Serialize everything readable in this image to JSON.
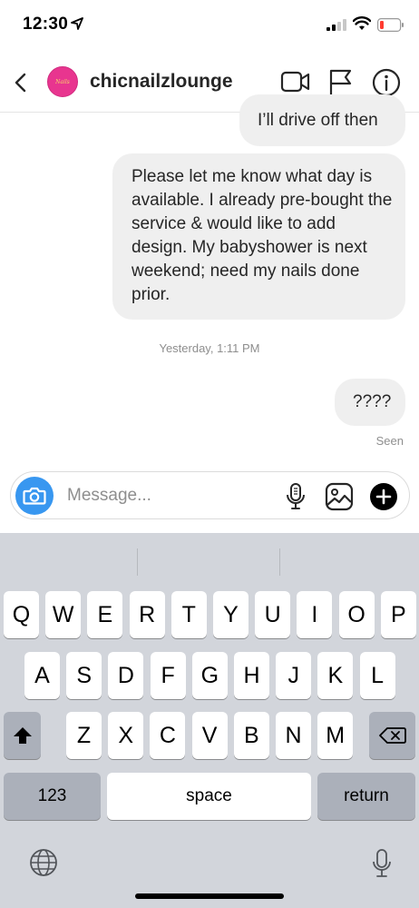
{
  "status_bar": {
    "time": "12:30"
  },
  "header": {
    "username": "chicnailzlounge",
    "avatar_text": "Nails"
  },
  "messages": [
    {
      "text": "I’ll drive off then"
    },
    {
      "text": "Please let me know what day is available.  I already pre-bought the service & would like to add design. My babyshower is next weekend; need my nails done prior."
    },
    {
      "text": "????"
    }
  ],
  "timestamp": "Yesterday, 1:11 PM",
  "seen_label": "Seen",
  "composer": {
    "placeholder": "Message..."
  },
  "keyboard": {
    "row1": [
      "Q",
      "W",
      "E",
      "R",
      "T",
      "Y",
      "U",
      "I",
      "O",
      "P"
    ],
    "row2": [
      "A",
      "S",
      "D",
      "F",
      "G",
      "H",
      "J",
      "K",
      "L"
    ],
    "row3": [
      "Z",
      "X",
      "C",
      "V",
      "B",
      "N",
      "M"
    ],
    "numbers_label": "123",
    "space_label": "space",
    "return_label": "return"
  },
  "colors": {
    "accent": "#3897f0",
    "bubble": "#efefef",
    "avatar": "#e8358f",
    "keyboard_bg": "#d2d5db"
  }
}
